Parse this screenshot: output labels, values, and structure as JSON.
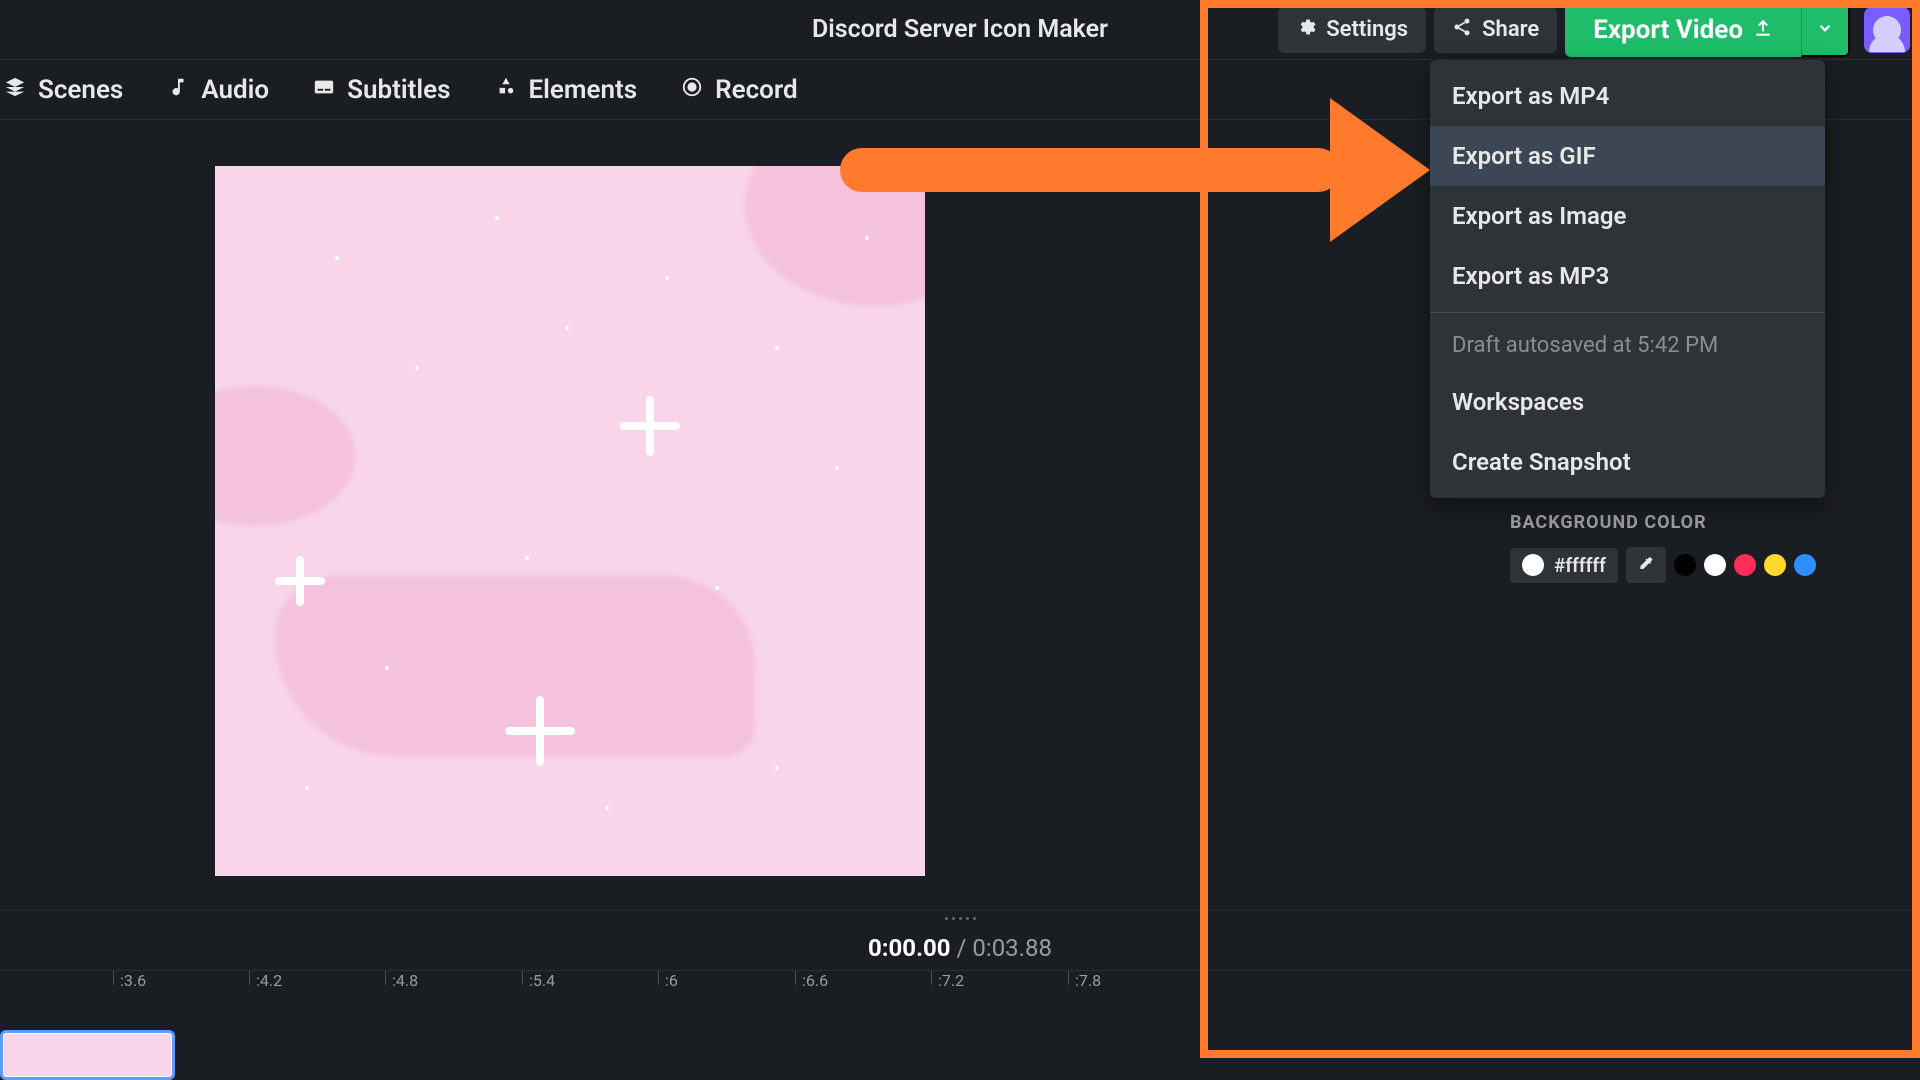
{
  "title": "Discord Server Icon Maker",
  "topButtons": {
    "settings": "Settings",
    "share": "Share",
    "exportVideo": "Export Video"
  },
  "tabs": {
    "scenes": "Scenes",
    "audio": "Audio",
    "subtitles": "Subtitles",
    "elements": "Elements",
    "record": "Record"
  },
  "exportMenu": {
    "items": [
      {
        "label": "Export as MP4",
        "highlighted": false
      },
      {
        "label": "Export as GIF",
        "highlighted": true
      },
      {
        "label": "Export as Image",
        "highlighted": false
      },
      {
        "label": "Export as MP3",
        "highlighted": false
      }
    ],
    "autosave": "Draft autosaved at 5:42 PM",
    "workspaces": "Workspaces",
    "snapshot": "Create Snapshot"
  },
  "bgColor": {
    "label": "BACKGROUND COLOR",
    "hex": "#ffffff",
    "swatches": [
      "#000000",
      "#ffffff",
      "#ff2d5a",
      "#ffd92d",
      "#2d8eff"
    ]
  },
  "timeline": {
    "current": "0:00.00",
    "separator": " / ",
    "total": "0:03.88",
    "ticks": [
      ":3.6",
      ":4.2",
      ":4.8",
      ":5.4",
      ":6",
      ":6.6",
      ":7.2",
      ":7.8"
    ]
  },
  "colors": {
    "accent": "#ff7a2d",
    "export": "#1fbd6a"
  }
}
